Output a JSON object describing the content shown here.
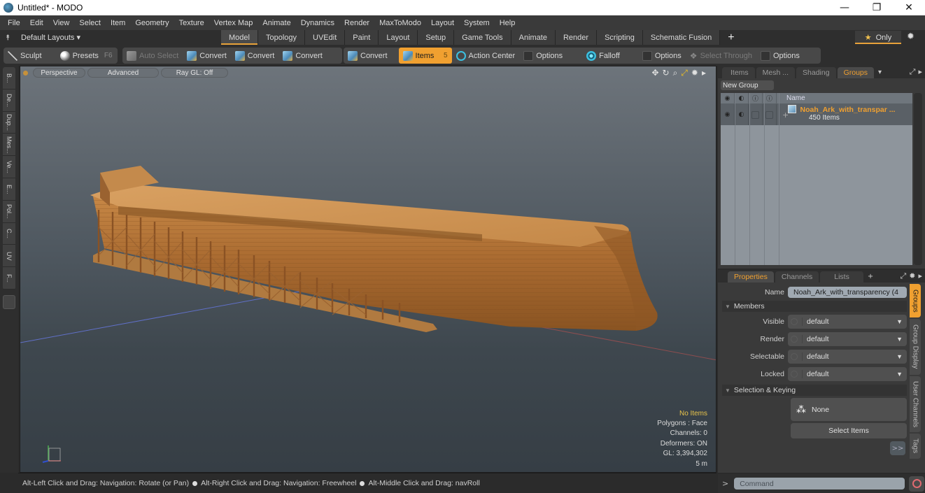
{
  "window": {
    "title": "Untitled* - MODO",
    "controls": {
      "minimize": "—",
      "maximize": "❐",
      "close": "✕"
    }
  },
  "menubar": {
    "items": [
      "File",
      "Edit",
      "View",
      "Select",
      "Item",
      "Geometry",
      "Texture",
      "Vertex Map",
      "Animate",
      "Dynamics",
      "Render",
      "MaxToModo",
      "Layout",
      "System",
      "Help"
    ]
  },
  "layoutbar": {
    "layouts_label": "Default Layouts ▾",
    "tabs": [
      {
        "label": "Model",
        "active": true
      },
      {
        "label": "Topology"
      },
      {
        "label": "UVEdit"
      },
      {
        "label": "Paint"
      },
      {
        "label": "Layout"
      },
      {
        "label": "Setup"
      },
      {
        "label": "Game Tools"
      },
      {
        "label": "Animate"
      },
      {
        "label": "Render"
      },
      {
        "label": "Scripting"
      },
      {
        "label": "Schematic Fusion"
      }
    ],
    "add_tab": "+",
    "only_label": "Only",
    "only_icon": "★"
  },
  "toolbar": {
    "sculpt": "Sculpt",
    "presets": "Presets",
    "presets_hotkey": "F6",
    "auto_select": "Auto Select",
    "convert1": "Convert",
    "convert2": "Convert",
    "convert3": "Convert",
    "convert4": "Convert",
    "items": "Items",
    "items_hotkey": "5",
    "action_center": "Action Center",
    "options1": "Options",
    "falloff": "Falloff",
    "options2": "Options",
    "select_through": "Select Through",
    "options3": "Options"
  },
  "left_tabs": [
    "B...",
    "De...",
    "Dup...",
    "Mes...",
    "Ve...",
    "E...",
    "Pol...",
    "C...",
    "UV",
    "F..."
  ],
  "viewport": {
    "view_mode": "Perspective",
    "shading": "Advanced",
    "raygl": "Ray GL: Off",
    "stats": {
      "selection": "No Items",
      "polygons": "Polygons : Face",
      "channels": "Channels: 0",
      "deformers": "Deformers: ON",
      "gl": "GL: 3,394,302",
      "scale": "5 m"
    }
  },
  "statusbar": {
    "hint1": "Alt-Left Click and Drag: Navigation: Rotate (or Pan)",
    "hint2": "Alt-Right Click and Drag: Navigation: Freewheel",
    "hint3": "Alt-Middle Click and Drag: navRoll"
  },
  "groups_panel": {
    "tabs": [
      {
        "label": "Items"
      },
      {
        "label": "Mesh ..."
      },
      {
        "label": "Shading"
      },
      {
        "label": "Groups",
        "active": true
      }
    ],
    "new_group": "New Group",
    "column_name": "Name",
    "rows": [
      {
        "name": "Noah_Ark_with_transpar ...",
        "count": "450 Items"
      }
    ]
  },
  "properties_panel": {
    "tabs": [
      {
        "label": "Properties",
        "active": true
      },
      {
        "label": "Channels"
      },
      {
        "label": "Lists"
      }
    ],
    "add_tab": "+",
    "name_label": "Name",
    "name_value": "Noah_Ark_with_transparency (4",
    "members_section": "Members",
    "fields": [
      {
        "label": "Visible",
        "value": "default"
      },
      {
        "label": "Render",
        "value": "default"
      },
      {
        "label": "Selectable",
        "value": "default"
      },
      {
        "label": "Locked",
        "value": "default"
      }
    ],
    "selection_section": "Selection & Keying",
    "none_button": "None",
    "select_items_button": "Select Items",
    "more_button": ">>",
    "side_tabs": [
      {
        "label": "Groups",
        "active": true
      },
      {
        "label": "Group Display"
      },
      {
        "label": "User Channels"
      },
      {
        "label": "Tags"
      }
    ]
  },
  "command": {
    "prompt": ">",
    "placeholder": "Command"
  }
}
